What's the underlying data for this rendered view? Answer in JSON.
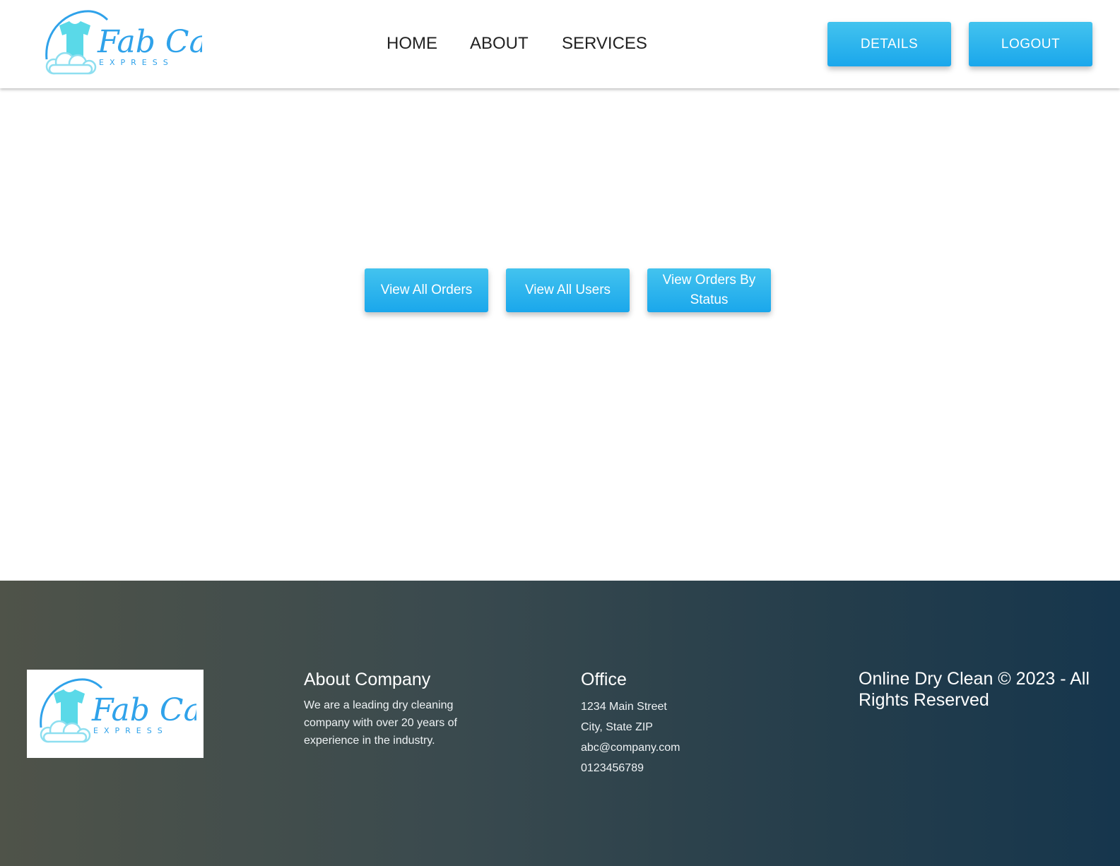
{
  "brand": {
    "name": "Fab Care",
    "tagline": "EXPRESS",
    "colors": {
      "script": "#2fa2ea",
      "shirt": "#5ad9e8",
      "cloud": "#8edff0"
    }
  },
  "nav": {
    "home": "HOME",
    "about": "ABOUT",
    "services": "SERVICES"
  },
  "header_buttons": {
    "details": "DETAILS",
    "logout": "LOGOUT"
  },
  "actions": {
    "view_all_orders": "View All Orders",
    "view_all_users": "View All Users",
    "view_orders_by_status": "View Orders By Status"
  },
  "footer": {
    "about": {
      "heading": "About Company",
      "text": "We are a leading dry cleaning company with over 20 years of experience in the industry."
    },
    "office": {
      "heading": "Office",
      "address_line1": "1234 Main Street",
      "address_line2": "City, State ZIP",
      "email": "abc@company.com",
      "phone": "0123456789"
    },
    "copyright": "Online Dry Clean © 2023 - All Rights Reserved"
  },
  "theme": {
    "button_gradient_top": "#43c3ee",
    "button_gradient_bottom": "#1aa7ec",
    "footer_left": "#4f5349",
    "footer_right": "#16364d"
  }
}
